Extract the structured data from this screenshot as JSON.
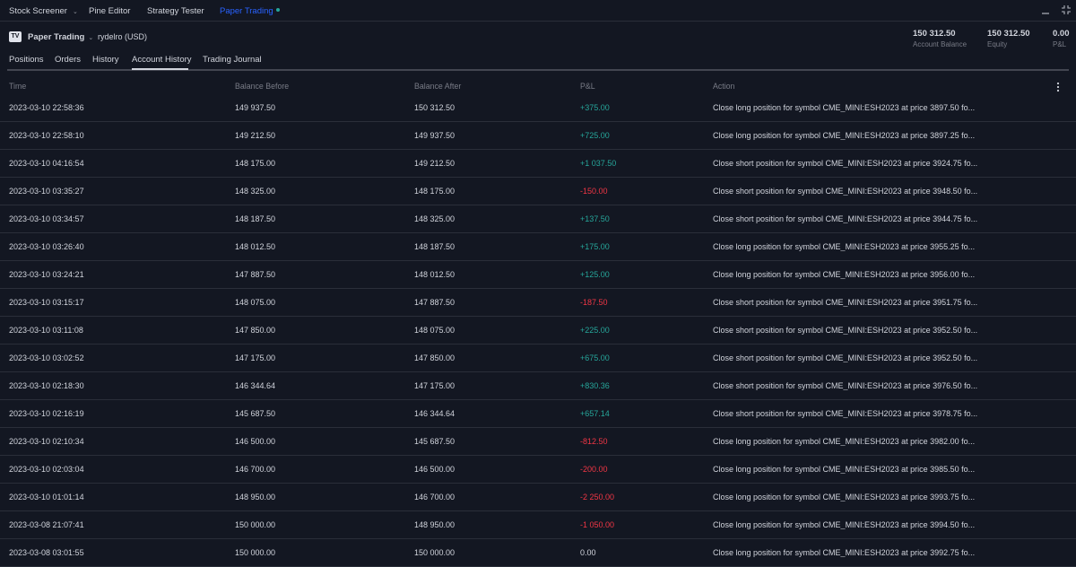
{
  "top_tabs": [
    {
      "label": "Stock Screener",
      "has_chevron": true,
      "active": false
    },
    {
      "label": "Pine Editor",
      "has_chevron": false,
      "active": false
    },
    {
      "label": "Strategy Tester",
      "has_chevron": false,
      "active": false
    },
    {
      "label": "Paper Trading",
      "has_chevron": false,
      "active": true,
      "status_dot": true
    }
  ],
  "window_controls": [
    "minimize-icon",
    "collapse-icon"
  ],
  "account": {
    "brand_icon": "TV",
    "broker_label": "Paper Trading",
    "account_name": "rydelro (USD)"
  },
  "summary": [
    {
      "value": "150 312.50",
      "label": "Account Balance"
    },
    {
      "value": "150 312.50",
      "label": "Equity"
    },
    {
      "value": "0.00",
      "label": "P&L"
    }
  ],
  "sub_tabs": [
    {
      "label": "Positions",
      "active": false
    },
    {
      "label": "Orders",
      "active": false
    },
    {
      "label": "History",
      "active": false
    },
    {
      "label": "Account History",
      "active": true
    },
    {
      "label": "Trading Journal",
      "active": false
    }
  ],
  "table": {
    "columns": [
      "Time",
      "Balance Before",
      "Balance After",
      "P&L",
      "Action"
    ],
    "rows": [
      {
        "time": "2023-03-10 22:58:36",
        "before": "149 937.50",
        "after": "150 312.50",
        "pnl": "+375.00",
        "sign": "pos",
        "action": "Close long position for symbol CME_MINI:ESH2023 at price 3897.50 fo..."
      },
      {
        "time": "2023-03-10 22:58:10",
        "before": "149 212.50",
        "after": "149 937.50",
        "pnl": "+725.00",
        "sign": "pos",
        "action": "Close long position for symbol CME_MINI:ESH2023 at price 3897.25 fo..."
      },
      {
        "time": "2023-03-10 04:16:54",
        "before": "148 175.00",
        "after": "149 212.50",
        "pnl": "+1 037.50",
        "sign": "pos",
        "action": "Close short position for symbol CME_MINI:ESH2023 at price 3924.75 fo..."
      },
      {
        "time": "2023-03-10 03:35:27",
        "before": "148 325.00",
        "after": "148 175.00",
        "pnl": "-150.00",
        "sign": "neg",
        "action": "Close short position for symbol CME_MINI:ESH2023 at price 3948.50 fo..."
      },
      {
        "time": "2023-03-10 03:34:57",
        "before": "148 187.50",
        "after": "148 325.00",
        "pnl": "+137.50",
        "sign": "pos",
        "action": "Close short position for symbol CME_MINI:ESH2023 at price 3944.75 fo..."
      },
      {
        "time": "2023-03-10 03:26:40",
        "before": "148 012.50",
        "after": "148 187.50",
        "pnl": "+175.00",
        "sign": "pos",
        "action": "Close long position for symbol CME_MINI:ESH2023 at price 3955.25 fo..."
      },
      {
        "time": "2023-03-10 03:24:21",
        "before": "147 887.50",
        "after": "148 012.50",
        "pnl": "+125.00",
        "sign": "pos",
        "action": "Close long position for symbol CME_MINI:ESH2023 at price 3956.00 fo..."
      },
      {
        "time": "2023-03-10 03:15:17",
        "before": "148 075.00",
        "after": "147 887.50",
        "pnl": "-187.50",
        "sign": "neg",
        "action": "Close short position for symbol CME_MINI:ESH2023 at price 3951.75 fo..."
      },
      {
        "time": "2023-03-10 03:11:08",
        "before": "147 850.00",
        "after": "148 075.00",
        "pnl": "+225.00",
        "sign": "pos",
        "action": "Close short position for symbol CME_MINI:ESH2023 at price 3952.50 fo..."
      },
      {
        "time": "2023-03-10 03:02:52",
        "before": "147 175.00",
        "after": "147 850.00",
        "pnl": "+675.00",
        "sign": "pos",
        "action": "Close short position for symbol CME_MINI:ESH2023 at price 3952.50 fo..."
      },
      {
        "time": "2023-03-10 02:18:30",
        "before": "146 344.64",
        "after": "147 175.00",
        "pnl": "+830.36",
        "sign": "pos",
        "action": "Close short position for symbol CME_MINI:ESH2023 at price 3976.50 fo..."
      },
      {
        "time": "2023-03-10 02:16:19",
        "before": "145 687.50",
        "after": "146 344.64",
        "pnl": "+657.14",
        "sign": "pos",
        "action": "Close short position for symbol CME_MINI:ESH2023 at price 3978.75 fo..."
      },
      {
        "time": "2023-03-10 02:10:34",
        "before": "146 500.00",
        "after": "145 687.50",
        "pnl": "-812.50",
        "sign": "neg",
        "action": "Close long position for symbol CME_MINI:ESH2023 at price 3982.00 fo..."
      },
      {
        "time": "2023-03-10 02:03:04",
        "before": "146 700.00",
        "after": "146 500.00",
        "pnl": "-200.00",
        "sign": "neg",
        "action": "Close long position for symbol CME_MINI:ESH2023 at price 3985.50 fo..."
      },
      {
        "time": "2023-03-10 01:01:14",
        "before": "148 950.00",
        "after": "146 700.00",
        "pnl": "-2 250.00",
        "sign": "neg",
        "action": "Close long position for symbol CME_MINI:ESH2023 at price 3993.75 fo..."
      },
      {
        "time": "2023-03-08 21:07:41",
        "before": "150 000.00",
        "after": "148 950.00",
        "pnl": "-1 050.00",
        "sign": "neg",
        "action": "Close long position for symbol CME_MINI:ESH2023 at price 3994.50 fo..."
      },
      {
        "time": "2023-03-08 03:01:55",
        "before": "150 000.00",
        "after": "150 000.00",
        "pnl": "0.00",
        "sign": "neu",
        "action": "Close long position for symbol CME_MINI:ESH2023 at price 3992.75 fo..."
      }
    ]
  },
  "colors": {
    "background": "#131722",
    "text": "#d1d4dc",
    "muted": "#787b86",
    "accent": "#2962ff",
    "positive": "#26a69a",
    "negative": "#f23645",
    "divider": "#2a2e39"
  }
}
